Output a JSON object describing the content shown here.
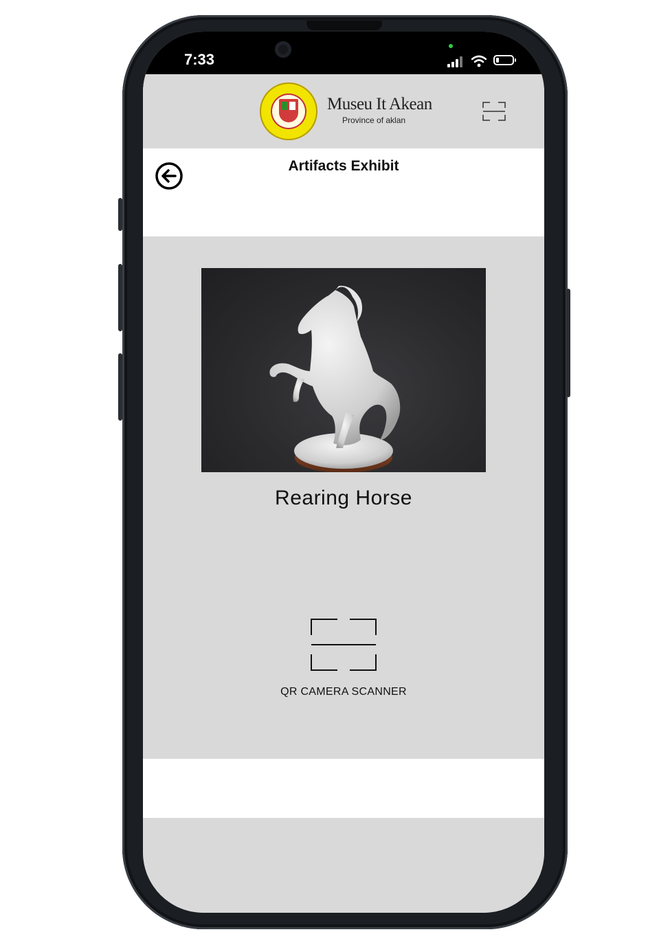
{
  "status_bar": {
    "time": "7:33"
  },
  "header": {
    "app_title": "Museu It Akean",
    "app_subtitle": "Province of aklan",
    "logo_icon": "official-seal-province-of-aklan"
  },
  "page": {
    "title": "Artifacts Exhibit",
    "back_icon": "back-arrow-circle-icon"
  },
  "artifact": {
    "name": "Rearing Horse",
    "image": "white porcelain rearing horse statuette on dark background"
  },
  "scanner": {
    "label": "QR CAMERA SCANNER",
    "icon": "qr-scanner-icon"
  },
  "colors": {
    "screen_bg": "#d9d9d9",
    "panel_bg": "#ffffff",
    "seal_yellow": "#f1e400",
    "seal_red": "#d23b3b"
  }
}
